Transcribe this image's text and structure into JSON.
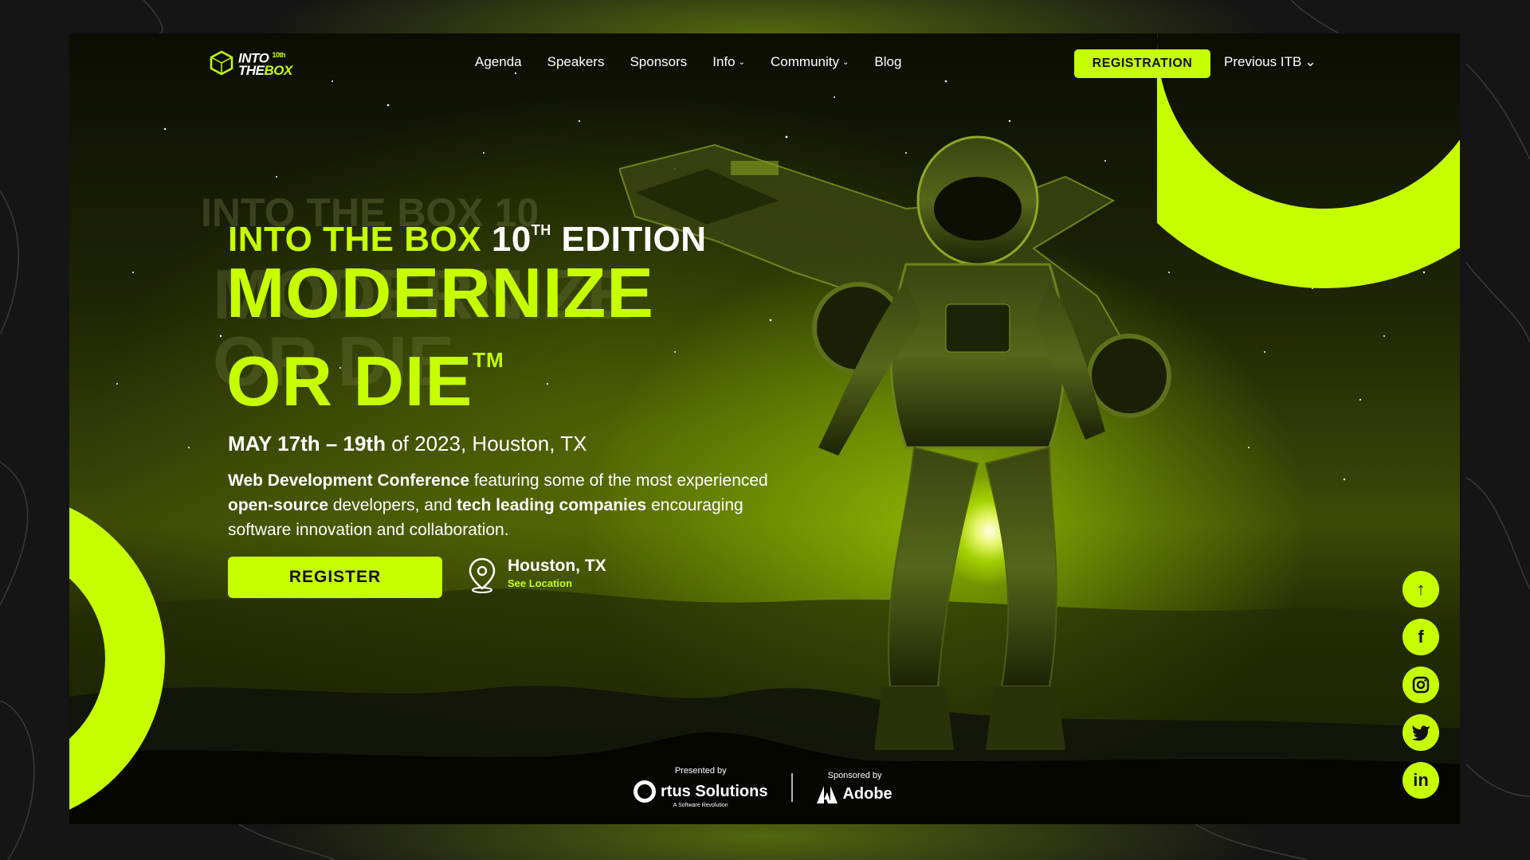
{
  "nav": {
    "logo": {
      "line1": "INTO",
      "line2": "THE",
      "box": "BOX",
      "edition": "10th"
    },
    "links": [
      {
        "label": "Agenda",
        "dropdown": false
      },
      {
        "label": "Speakers",
        "dropdown": false
      },
      {
        "label": "Sponsors",
        "dropdown": false
      },
      {
        "label": "Info",
        "dropdown": true
      },
      {
        "label": "Community",
        "dropdown": true
      },
      {
        "label": "Blog",
        "dropdown": false
      }
    ],
    "registration_label": "REGISTRATION",
    "previous_label": "Previous ITB"
  },
  "hero": {
    "edition_prefix": "INTO THE BOX",
    "edition_num": "10",
    "edition_sup": "TH",
    "edition_suffix": "EDITION",
    "headline_line1": "MODERNIZE",
    "headline_line2": "OR DIE",
    "headline_tm": "TM",
    "dates_bold": "MAY 17th – 19th",
    "dates_rest": "of 2023, Houston, TX",
    "desc_bold1": "Web Development Conference",
    "desc_text1": "featuring some of the most experienced",
    "desc_bold2": "open-source",
    "desc_text2": "developers, and",
    "desc_bold3": "tech leading companies",
    "desc_text3": "encouraging software innovation and collaboration.",
    "register_label": "REGISTER",
    "location_city": "Houston, TX",
    "location_link": "See Location"
  },
  "social": [
    "arrow-up-icon",
    "facebook-icon",
    "instagram-icon",
    "twitter-icon",
    "linkedin-icon"
  ],
  "sponsors": {
    "presented_caption": "Presented by",
    "presenter": "rtus Solutions",
    "presenter_tagline": "A Software Revolution",
    "sponsored_caption": "Sponsored by",
    "sponsor": "Adobe"
  },
  "colors": {
    "accent": "#c6ff00",
    "background": "#151515",
    "text": "#ffffff"
  }
}
